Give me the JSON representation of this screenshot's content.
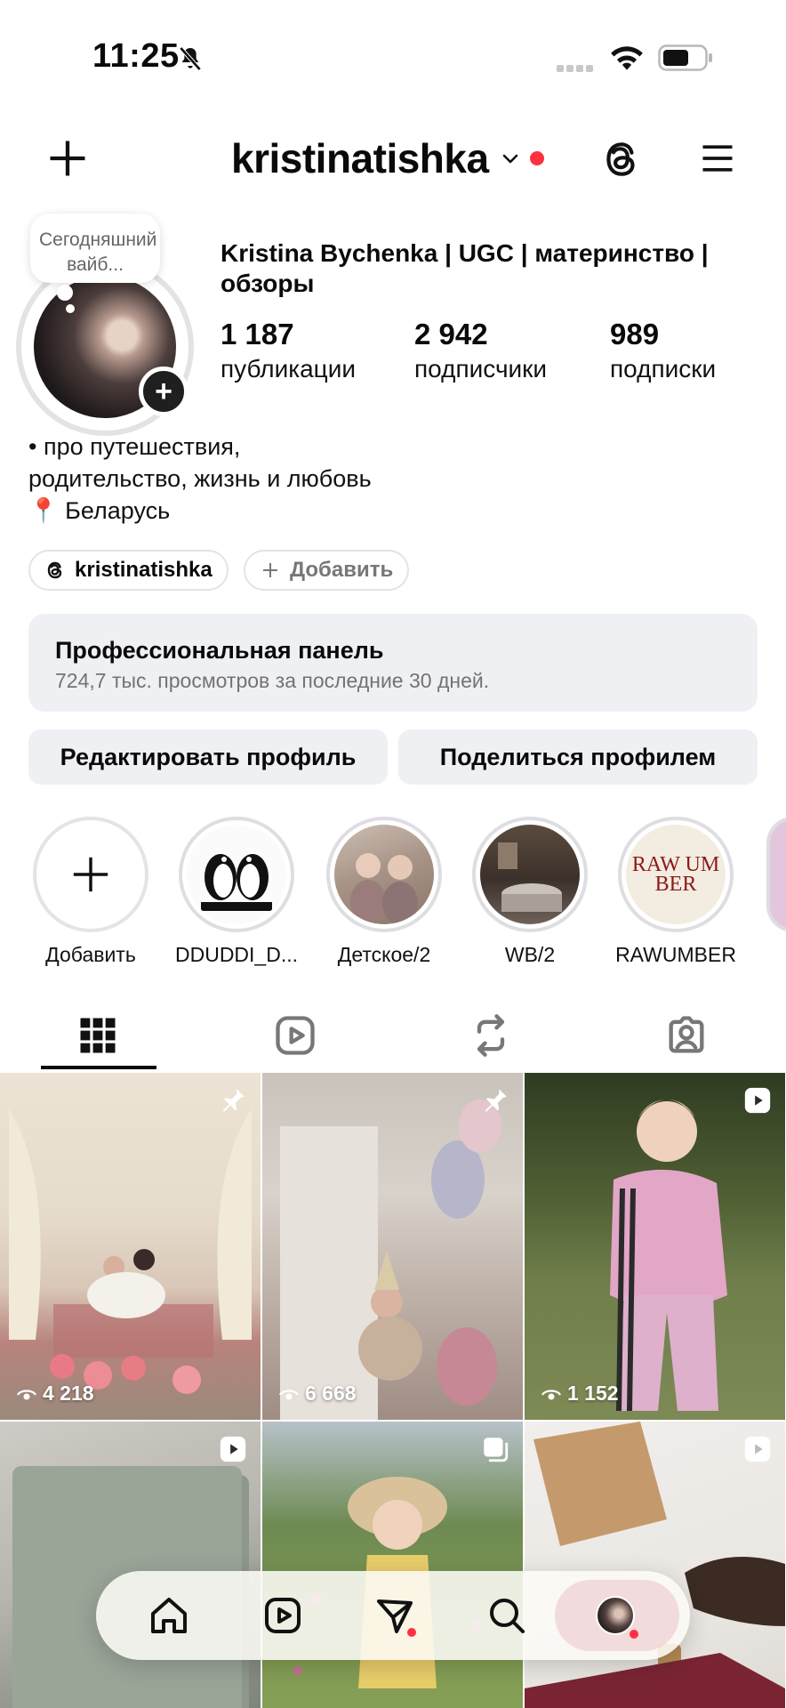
{
  "status_bar": {
    "time": "11:25"
  },
  "header": {
    "username": "kristinatishka"
  },
  "profile": {
    "note": "Сегодняшний вайб...",
    "display_name": "Kristina Bychenka | UGC | материнство | обзоры",
    "stats": [
      {
        "value": "1 187",
        "label": "публикации"
      },
      {
        "value": "2 942",
        "label": "подписчики"
      },
      {
        "value": "989",
        "label": "подписки"
      }
    ],
    "bio_lines": [
      "• про путешествия,",
      "родительство, жизнь и любовь",
      "📍 Беларусь"
    ]
  },
  "chips": {
    "threads": "kristinatishka",
    "add": "Добавить"
  },
  "pro_panel": {
    "title": "Профессиональная панель",
    "subtitle": "724,7 тыс. просмотров за последние 30 дней."
  },
  "buttons": {
    "edit": "Редактировать профиль",
    "share": "Поделиться профилем"
  },
  "highlights": [
    {
      "label": "Добавить"
    },
    {
      "label": "DDUDDI_D..."
    },
    {
      "label": "Детское/2"
    },
    {
      "label": "WB/2"
    },
    {
      "label": "RAWUMBER",
      "logo": "RAW UM BER"
    }
  ],
  "posts": [
    {
      "views": "4 218",
      "badge": "pin"
    },
    {
      "views": "6 668",
      "badge": "pin"
    },
    {
      "views": "1 152",
      "badge": "reel"
    },
    {
      "views": "",
      "badge": "reel"
    },
    {
      "views": "",
      "badge": "carousel"
    },
    {
      "views": "",
      "badge": "reel"
    }
  ],
  "colors": {
    "notification_red": "#ff3040",
    "panel_bg": "#eff0f3",
    "muted_text": "#737373"
  }
}
